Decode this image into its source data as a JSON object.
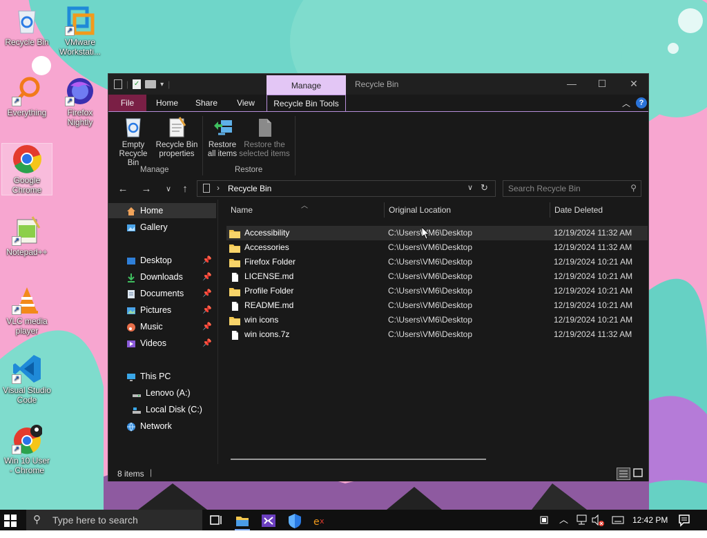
{
  "desktop": {
    "icons": [
      {
        "label": "Recycle Bin",
        "icon": "recycle-bin-icon"
      },
      {
        "label": "VMware Workstati...",
        "icon": "vmware-icon"
      },
      {
        "label": "Everything",
        "icon": "everything-search-icon"
      },
      {
        "label": "Firefox Nightly",
        "icon": "firefox-nightly-icon"
      },
      {
        "label": "Google Chrome",
        "icon": "chrome-icon"
      },
      {
        "label": "Notepad++",
        "icon": "notepadpp-icon"
      },
      {
        "label": "VLC media player",
        "icon": "vlc-icon"
      },
      {
        "label": "Visual Studio Code",
        "icon": "vscode-icon"
      },
      {
        "label": "Win 10 User - Chrome",
        "icon": "chrome-profile-icon"
      }
    ]
  },
  "window": {
    "title": "Recycle Bin",
    "context_tab": "Manage",
    "tabs": {
      "file": "File",
      "home": "Home",
      "share": "Share",
      "view": "View",
      "tools": "Recycle Bin Tools"
    },
    "ribbon": {
      "empty": {
        "line1": "Empty",
        "line2": "Recycle Bin"
      },
      "properties": {
        "line1": "Recycle Bin",
        "line2": "properties"
      },
      "restore_all": {
        "line1": "Restore",
        "line2": "all items"
      },
      "restore_selected": {
        "line1": "Restore the",
        "line2": "selected items"
      },
      "group_manage": "Manage",
      "group_restore": "Restore"
    },
    "address": {
      "path": "Recycle Bin",
      "search_placeholder": "Search Recycle Bin"
    },
    "nav": {
      "home": "Home",
      "gallery": "Gallery",
      "desktop": "Desktop",
      "downloads": "Downloads",
      "documents": "Documents",
      "pictures": "Pictures",
      "music": "Music",
      "videos": "Videos",
      "this_pc": "This PC",
      "drive_a": "Lenovo (A:)",
      "drive_c": "Local Disk (C:)",
      "network": "Network"
    },
    "columns": {
      "name": "Name",
      "location": "Original Location",
      "date": "Date Deleted"
    },
    "files": [
      {
        "name": "Accessibility",
        "location": "C:\\Users\\VM6\\Desktop",
        "date": "12/19/2024 11:32 AM",
        "type": "folder"
      },
      {
        "name": "Accessories",
        "location": "C:\\Users\\VM6\\Desktop",
        "date": "12/19/2024 11:32 AM",
        "type": "folder"
      },
      {
        "name": "Firefox Folder",
        "location": "C:\\Users\\VM6\\Desktop",
        "date": "12/19/2024 10:21 AM",
        "type": "folder"
      },
      {
        "name": "LICENSE.md",
        "location": "C:\\Users\\VM6\\Desktop",
        "date": "12/19/2024 10:21 AM",
        "type": "file"
      },
      {
        "name": "Profile Folder",
        "location": "C:\\Users\\VM6\\Desktop",
        "date": "12/19/2024 10:21 AM",
        "type": "folder"
      },
      {
        "name": "README.md",
        "location": "C:\\Users\\VM6\\Desktop",
        "date": "12/19/2024 10:21 AM",
        "type": "file"
      },
      {
        "name": "win icons",
        "location": "C:\\Users\\VM6\\Desktop",
        "date": "12/19/2024 10:21 AM",
        "type": "folder"
      },
      {
        "name": "win icons.7z",
        "location": "C:\\Users\\VM6\\Desktop",
        "date": "12/19/2024 11:32 AM",
        "type": "file"
      }
    ],
    "status": "8 items"
  },
  "taskbar": {
    "search_placeholder": "Type here to search",
    "time": "12:42 PM"
  },
  "colors": {
    "accent_file_tab": "#7a1f45",
    "context_tab": "#e3c6f5",
    "folder": "#f3c74e"
  }
}
